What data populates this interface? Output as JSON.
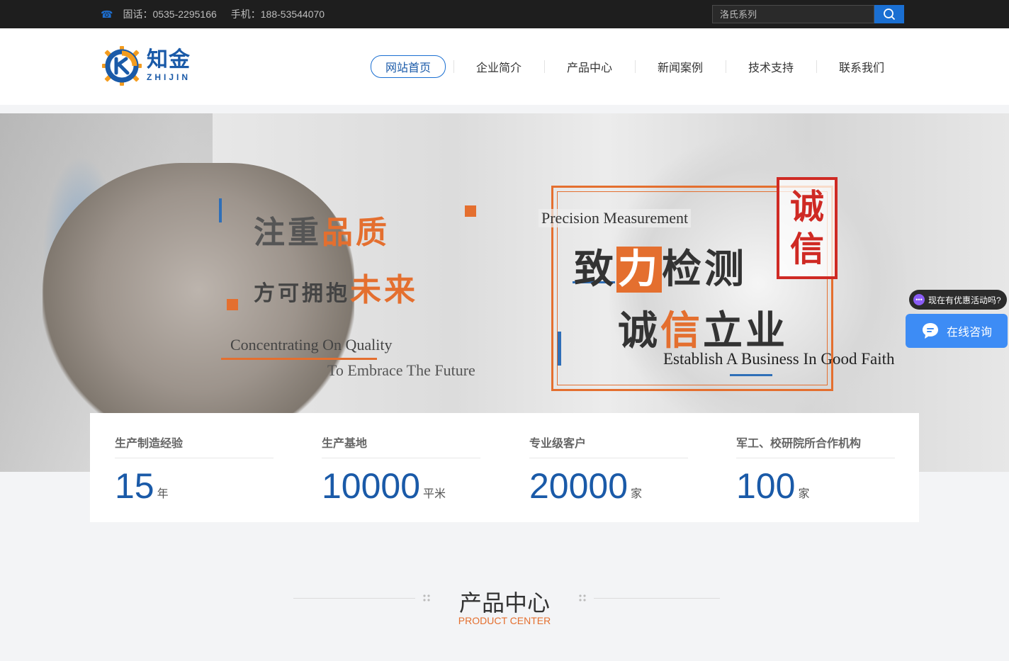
{
  "topbar": {
    "phone": "固话：0535-2295166",
    "mobile": "手机：188-53544070",
    "search_placeholder": "洛氏系列"
  },
  "logo": {
    "cn": "知金",
    "en": "ZHIJIN"
  },
  "nav": [
    {
      "label": "网站首页",
      "active": true
    },
    {
      "label": "企业简介"
    },
    {
      "label": "产品中心"
    },
    {
      "label": "新闻案例"
    },
    {
      "label": "技术支持"
    },
    {
      "label": "联系我们"
    }
  ],
  "banner": {
    "left_line1_a": "注重",
    "left_line1_b": "品质",
    "left_line2_a": "方可拥抱",
    "left_line2_b": "未来",
    "left_en1": "Concentrating On Quality",
    "left_en2": "To Embrace The Future",
    "precision": "Precision Measurement",
    "right_line1_a": "致",
    "right_line1_b": "力",
    "right_line1_c": "检测",
    "right_line2_a": "诚",
    "right_line2_b": "信",
    "right_line2_c": "立业",
    "right_en": "Establish A Business In Good Faith",
    "seal_1": "诚",
    "seal_2": "信"
  },
  "widgets": {
    "bubble": "现在有优惠活动吗?",
    "consult": "在线咨询"
  },
  "stats": [
    {
      "label": "生产制造经验",
      "value": "15",
      "unit": "年"
    },
    {
      "label": "生产基地",
      "value": "10000",
      "unit": "平米"
    },
    {
      "label": "专业级客户",
      "value": "20000",
      "unit": "家"
    },
    {
      "label": "军工、校研院所合作机构",
      "value": "100",
      "unit": "家"
    }
  ],
  "products": {
    "title": "产品中心",
    "subtitle": "PRODUCT CENTER"
  },
  "colors": {
    "brand_blue": "#1a5aa8",
    "accent_orange": "#e46f2f",
    "search_button": "#1a6fd2",
    "consult_button": "#3d8cf5"
  }
}
